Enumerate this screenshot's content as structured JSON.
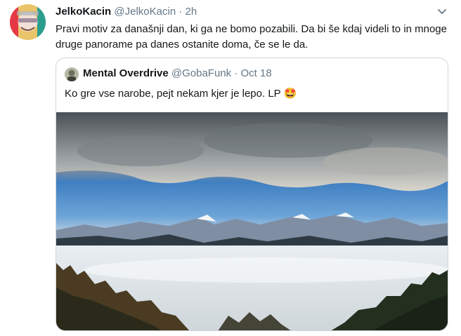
{
  "tweet": {
    "display_name": "JelkoKacin",
    "handle": "@JelkoKacin",
    "separator": "·",
    "time": "2h",
    "text": "Pravi motiv za današnji dan, ki ga ne bomo pozabili. Da bi še kdaj videli to in mnoge druge panorame pa danes ostanite doma, če se le da.",
    "menu_icon": "chevron-down-icon"
  },
  "quoted_tweet": {
    "display_name": "Mental Overdrive",
    "handle": "@GobaFunk",
    "separator": "·",
    "time": "Oct 18",
    "text": "Ko gre vse narobe, pejt nekam kjer je lepo. LP",
    "emoji": "🤩"
  },
  "colors": {
    "text": "#14171a",
    "muted": "#657786",
    "border": "#ccd6dd"
  }
}
